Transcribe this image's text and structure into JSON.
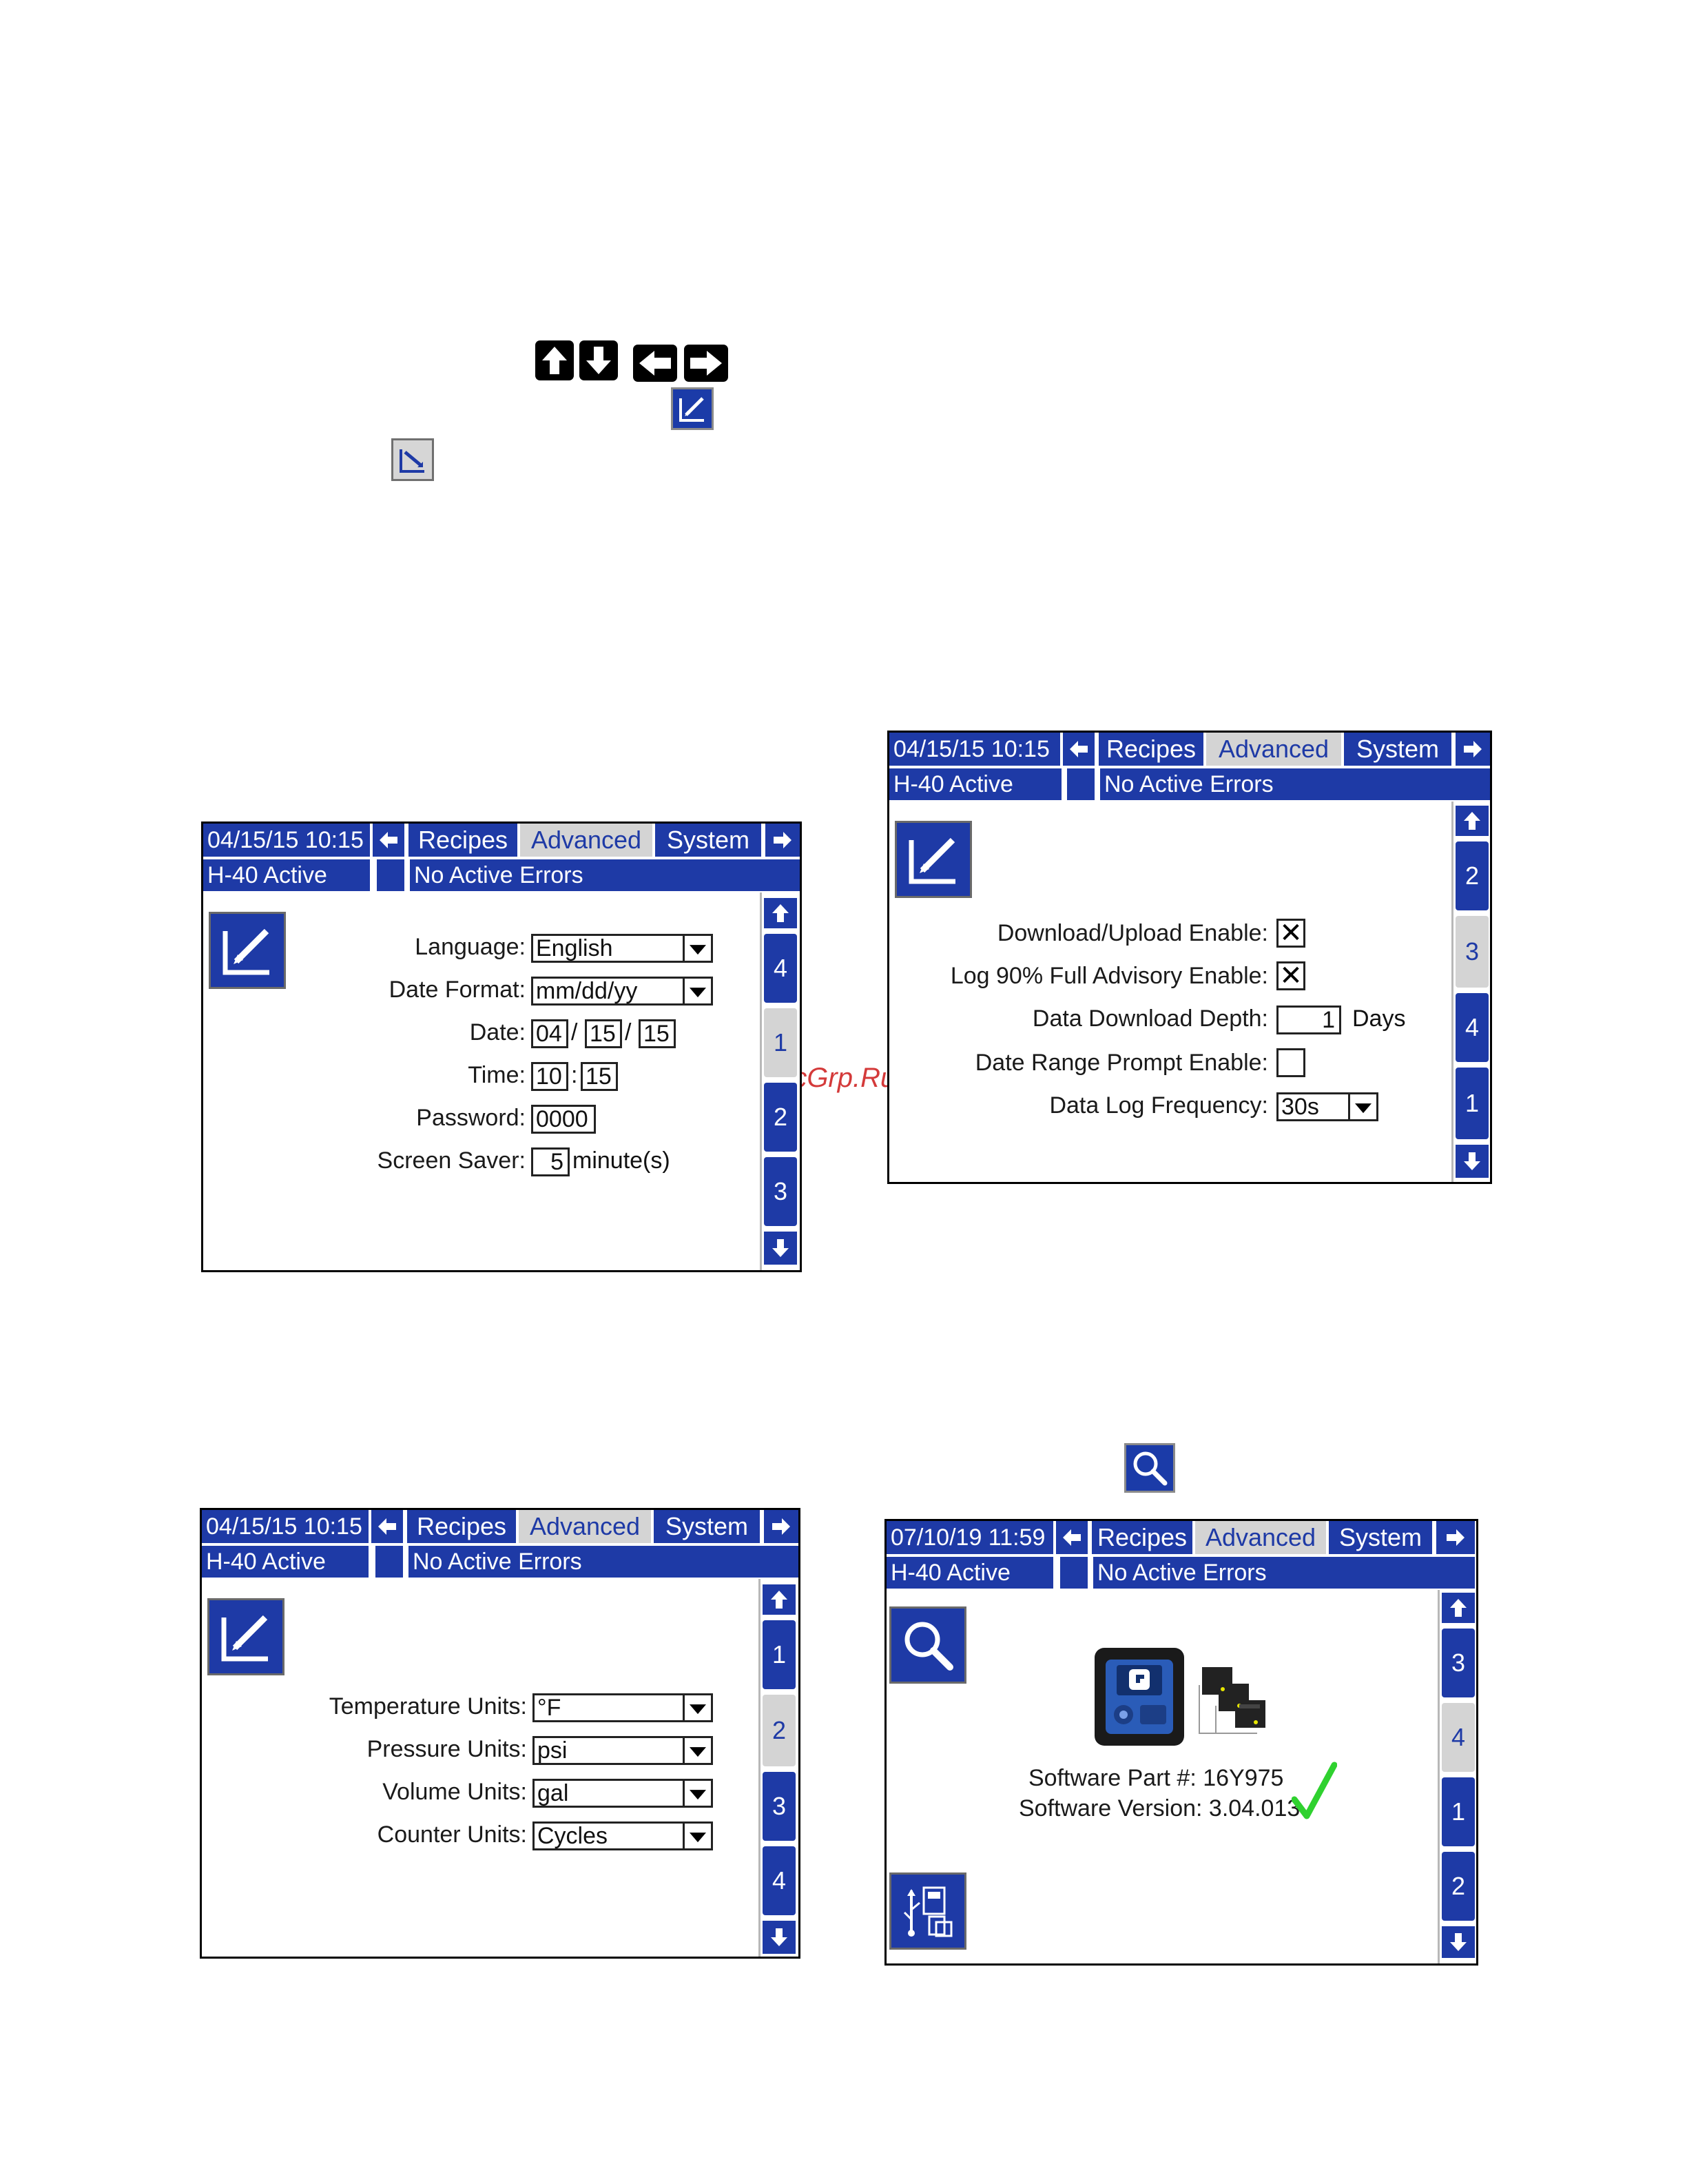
{
  "top_keys": {
    "up_icon": "arrow-up-icon",
    "down_icon": "arrow-down-icon",
    "left_icon": "arrow-left-icon",
    "right_icon": "arrow-right-icon",
    "edit_icon": "edit-pencil-icon",
    "exit_edit_icon": "exit-edit-icon"
  },
  "watermark": "McGrp.Ru",
  "colors": {
    "header_blue": "#1e3aa6",
    "tab_active_bg": "#d4d4d4",
    "check_green": "#2fd12f"
  },
  "screen1": {
    "datetime": "04/15/15 10:15",
    "status": "H-40 Active",
    "errors": "No Active Errors",
    "tabs": [
      "Recipes",
      "Advanced",
      "System"
    ],
    "active_tab": "Advanced",
    "page_tabs": [
      "4",
      "1",
      "2",
      "3"
    ],
    "active_page": "1",
    "fields": {
      "language_label": "Language:",
      "language_value": "English",
      "date_format_label": "Date Format:",
      "date_format_value": "mm/dd/yy",
      "date_label": "Date:",
      "date_month": "04",
      "date_day": "15",
      "date_year": "15",
      "date_sep": "/",
      "time_label": "Time:",
      "time_hour": "10",
      "time_minute": "15",
      "time_sep": ":",
      "password_label": "Password:",
      "password_value": "0000",
      "saver_label": "Screen Saver:",
      "saver_value": "5",
      "saver_unit": "minute(s)"
    }
  },
  "screen2": {
    "datetime": "04/15/15 10:15",
    "status": "H-40 Active",
    "errors": "No Active Errors",
    "tabs": [
      "Recipes",
      "Advanced",
      "System"
    ],
    "active_tab": "Advanced",
    "page_tabs": [
      "2",
      "3",
      "4",
      "1"
    ],
    "active_page": "3",
    "fields": {
      "download_label": "Download/Upload Enable:",
      "download_checked": true,
      "download_mark": "✕",
      "advisory_label": "Log 90% Full Advisory Enable:",
      "advisory_checked": true,
      "advisory_mark": "✕",
      "depth_label": "Data Download Depth:",
      "depth_value": "1",
      "depth_unit": "Days",
      "range_label": "Date Range Prompt Enable:",
      "range_checked": false,
      "range_mark": "",
      "freq_label": "Data Log Frequency:",
      "freq_value": "30s"
    }
  },
  "screen3": {
    "datetime": "04/15/15 10:15",
    "status": "H-40 Active",
    "errors": "No Active Errors",
    "tabs": [
      "Recipes",
      "Advanced",
      "System"
    ],
    "active_tab": "Advanced",
    "page_tabs": [
      "1",
      "2",
      "3",
      "4"
    ],
    "active_page": "2",
    "fields": {
      "temp_label": "Temperature Units:",
      "temp_value": "°F",
      "pressure_label": "Pressure Units:",
      "pressure_value": "psi",
      "volume_label": "Volume Units:",
      "volume_value": "gal",
      "counter_label": "Counter Units:",
      "counter_value": "Cycles"
    }
  },
  "search_key": {
    "icon": "search-icon"
  },
  "screen4": {
    "datetime": "07/10/19 11:59",
    "status": "H-40 Active",
    "errors": "No Active Errors",
    "tabs": [
      "Recipes",
      "Advanced",
      "System"
    ],
    "active_tab": "Advanced",
    "page_tabs": [
      "3",
      "4",
      "1",
      "2"
    ],
    "active_page": "4",
    "software_part": "Software Part #: 16Y975",
    "software_version": "Software Version: 3.04.013",
    "check_icon": "checkmark-icon",
    "usb_icon": "usb-transfer-icon",
    "display_module_icon": "display-module-icon",
    "network_icon": "network-modules-icon"
  }
}
